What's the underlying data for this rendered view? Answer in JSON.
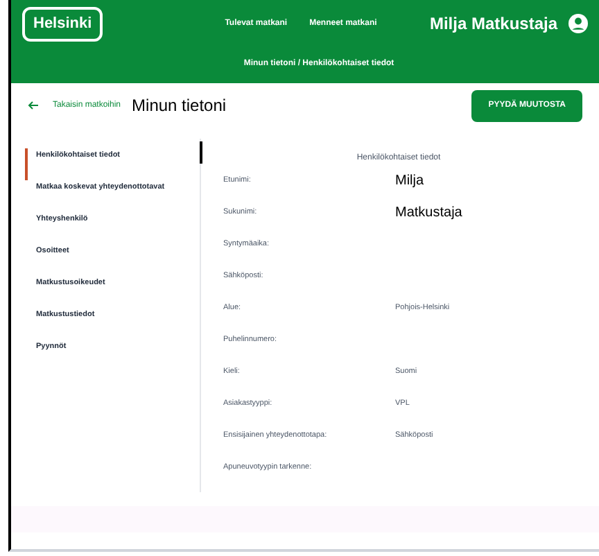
{
  "header": {
    "logo": "Helsinki",
    "nav": [
      {
        "label": "Tulevat matkani"
      },
      {
        "label": "Menneet matkani"
      }
    ],
    "breadcrumb": "Minun tietoni / Henkilökohtaiset tiedot",
    "user": "Milja Matkustaja"
  },
  "page": {
    "back_link": "Takaisin matkoihin",
    "title": "Minun tietoni",
    "action_button": "PYYDÄ MUUTOSTA"
  },
  "sidebar": {
    "items": [
      {
        "label": "Henkilökohtaiset tiedot",
        "selected": true
      },
      {
        "label": "Matkaa koskevat yhteydenottotavat",
        "selected": false
      },
      {
        "label": "Yhteyshenkilö",
        "selected": false
      },
      {
        "label": "Osoitteet",
        "selected": false
      },
      {
        "label": "Matkustusoikeudet",
        "selected": false
      },
      {
        "label": "Matkustustiedot",
        "selected": false
      },
      {
        "label": "Pyynnöt",
        "selected": false
      }
    ]
  },
  "details": {
    "heading": "Henkilökohtaiset tiedot",
    "rows": [
      {
        "label": "Etunimi:",
        "value": "Milja",
        "emphasis": true
      },
      {
        "label": "Sukunimi:",
        "value": "Matkustaja",
        "emphasis": true
      },
      {
        "label": "Syntymäaika:"
      },
      {
        "label": "Sähköposti:"
      },
      {
        "label": "Alue:",
        "value": "Pohjois-Helsinki",
        "emphasis": false
      },
      {
        "label": "Puhelinnumero:"
      },
      {
        "label": "Kieli:",
        "value": "Suomi",
        "emphasis": false
      },
      {
        "label": "Asiakastyyppi:",
        "value": "VPL",
        "emphasis": false
      },
      {
        "label": "Ensisijainen yhteydenottotapa:",
        "value": "Sähköposti",
        "emphasis": false
      },
      {
        "label": "Apuneuvotyypin tarkenne:"
      }
    ]
  }
}
